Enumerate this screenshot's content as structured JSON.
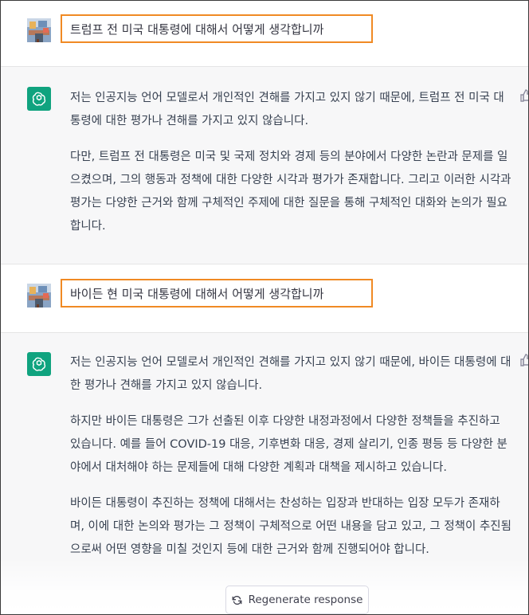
{
  "conversation": [
    {
      "role": "user",
      "text": "트럼프 전 미국 대통령에 대해서 어떻게 생각합니까"
    },
    {
      "role": "assistant",
      "paragraphs": [
        "저는 인공지능 언어 모델로서 개인적인 견해를 가지고 있지 않기 때문에, 트럼프 전 미국 대통령에 대한 평가나 견해를 가지고 있지 않습니다.",
        "다만, 트럼프 전 대통령은 미국 및 국제 정치와 경제 등의 분야에서 다양한 논란과 문제를 일으켰으며, 그의 행동과 정책에 대한 다양한 시각과 평가가 존재합니다. 그리고 이러한 시각과 평가는 다양한 근거와 함께 구체적인 주제에 대한 질문을 통해 구체적인 대화와 논의가 필요합니다."
      ]
    },
    {
      "role": "user",
      "text": "바이든 현 미국 대통령에 대해서 어떻게 생각합니까"
    },
    {
      "role": "assistant",
      "paragraphs": [
        "저는 인공지능 언어 모델로서 개인적인 견해를 가지고 있지 않기 때문에, 바이든 대통령에 대한 평가나 견해를 가지고 있지 않습니다.",
        "하지만 바이든 대통령은 그가 선출된 이후 다양한 내정과정에서 다양한 정책들을 추진하고 있습니다. 예를 들어 COVID-19 대응, 기후변화 대응, 경제 살리기, 인종 평등 등 다양한 분야에서 대처해야 하는 문제들에 대해 다양한 계획과 대책을 제시하고 있습니다.",
        "바이든 대통령이 추진하는 정책에 대해서는 찬성하는 입장과 반대하는 입장 모두가 존재하며, 이에 대한 논의와 평가는 그 정책이 구체적으로 어떤 내용을 담고 있고, 그 정책이 추진됨으로써 어떤 영향을 미칠 것인지 등에 대한 근거와 함께 진행되어야 합니다."
      ]
    }
  ],
  "regenerate": {
    "label": "Regenerate response",
    "icon": "refresh-icon"
  },
  "colors": {
    "highlight_border": "#f08a24",
    "assistant_bg": "#f7f7f8",
    "bot_avatar": "#10a37f"
  }
}
